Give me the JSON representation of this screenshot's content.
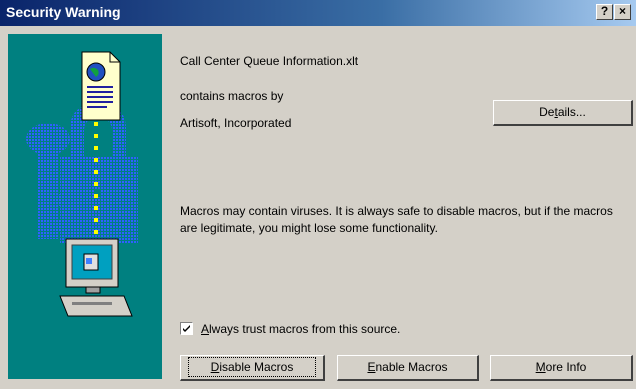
{
  "window": {
    "title": "Security Warning",
    "help_label": "?",
    "close_label": "×"
  },
  "dialog": {
    "filename": "Call Center Queue Information.xlt",
    "contains_text": "contains macros by",
    "publisher": "Artisoft, Incorporated",
    "warning": "Macros may contain viruses. It is always safe to disable macros, but if the macros are legitimate, you might lose some functionality."
  },
  "checkbox": {
    "label_pre": "",
    "label_ul": "A",
    "label_post": "lways trust macros from this source.",
    "checked": true
  },
  "buttons": {
    "details": {
      "pre": "De",
      "ul": "t",
      "post": "ails..."
    },
    "disable": {
      "pre": "",
      "ul": "D",
      "post": "isable Macros"
    },
    "enable": {
      "pre": "",
      "ul": "E",
      "post": "nable Macros"
    },
    "more_info": {
      "pre": "",
      "ul": "M",
      "post": "ore Info"
    }
  },
  "colors": {
    "title_start": "#0a246a",
    "title_end": "#a6caf0",
    "art_panel": "#008080",
    "dialog_bg": "#d4d0c8"
  },
  "icons": [
    "document-globe-icon",
    "padlock-icon",
    "key-icon",
    "computer-icon"
  ]
}
